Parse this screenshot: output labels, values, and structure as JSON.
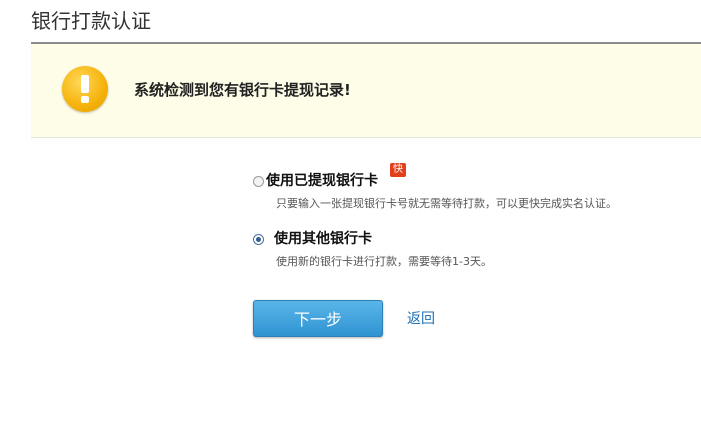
{
  "page": {
    "title": "银行打款认证"
  },
  "notice": {
    "icon": "exclamation-warning-icon",
    "text": "系统检测到您有银行卡提现记录!"
  },
  "options": [
    {
      "label": "使用已提现银行卡",
      "badge": "快",
      "description": "只要输入一张提现银行卡号就无需等待打款，可以更快完成实名认证。",
      "selected": false
    },
    {
      "label": "使用其他银行卡",
      "description": "使用新的银行卡进行打款，需要等待1-3天。",
      "selected": true
    }
  ],
  "actions": {
    "next_label": "下一步",
    "back_label": "返回"
  },
  "colors": {
    "notice_bg": "#fefde8",
    "button_blue": "#2f93d2",
    "link_blue": "#1c6fb6",
    "badge_red": "#e2401b"
  }
}
